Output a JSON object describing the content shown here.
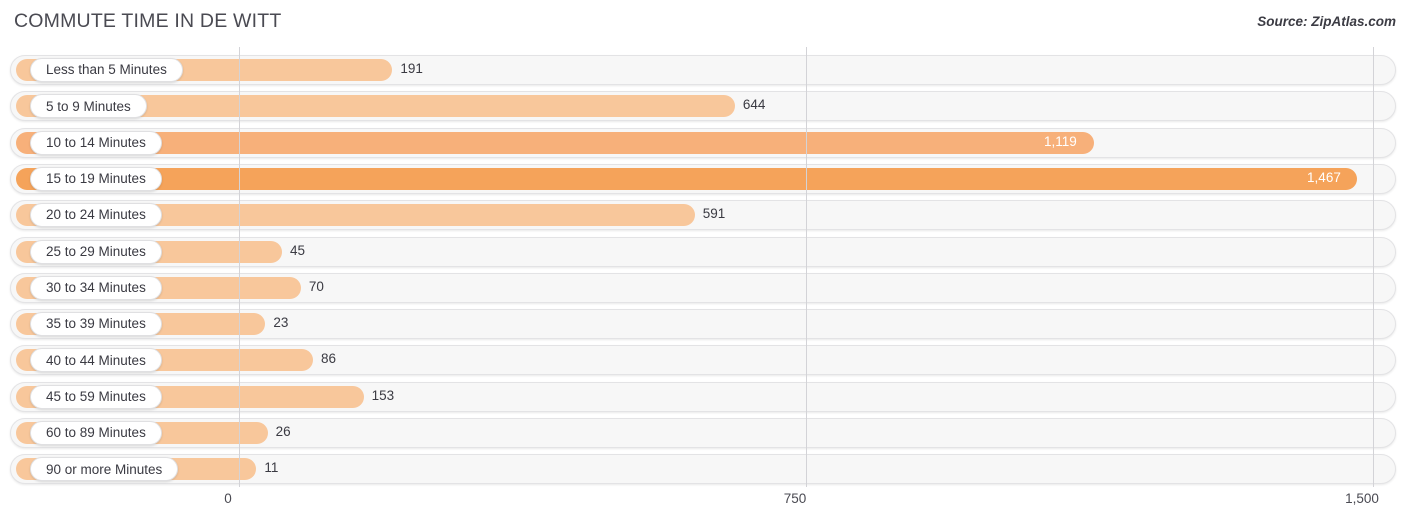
{
  "header": {
    "title": "COMMUTE TIME IN DE WITT",
    "source": "Source: ZipAtlas.com"
  },
  "axis": {
    "ticks": [
      {
        "label": "0",
        "value": 0
      },
      {
        "label": "750",
        "value": 750
      },
      {
        "label": "1,500",
        "value": 1500
      }
    ]
  },
  "colors": {
    "bar_light": "#f8c79b",
    "bar_mid": "#f7b97f",
    "bar_dark": "#f5a65e",
    "bar_darkest": "#f49f50",
    "track_bg": "#f7f7f7",
    "track_border": "#e3e3e5",
    "gridline": "#d3d3d7",
    "text": "#3a3a42",
    "title_text": "#4a4a52"
  },
  "chart_data": {
    "type": "bar",
    "orientation": "horizontal",
    "title": "COMMUTE TIME IN DE WITT",
    "xlabel": "",
    "ylabel": "",
    "xlim": [
      0,
      1500
    ],
    "grid": true,
    "legend": false,
    "source": "Source: ZipAtlas.com",
    "categories": [
      "Less than 5 Minutes",
      "5 to 9 Minutes",
      "10 to 14 Minutes",
      "15 to 19 Minutes",
      "20 to 24 Minutes",
      "25 to 29 Minutes",
      "30 to 34 Minutes",
      "35 to 39 Minutes",
      "40 to 44 Minutes",
      "45 to 59 Minutes",
      "60 to 89 Minutes",
      "90 or more Minutes"
    ],
    "values": [
      191,
      644,
      1119,
      1467,
      591,
      45,
      70,
      23,
      86,
      153,
      26,
      11
    ],
    "value_labels": [
      "191",
      "644",
      "1,119",
      "1,467",
      "591",
      "45",
      "70",
      "23",
      "86",
      "153",
      "26",
      "11"
    ],
    "bars": [
      {
        "category": "Less than 5 Minutes",
        "value": 191,
        "label": "191",
        "color": "#f8c79b",
        "label_inside": false
      },
      {
        "category": "5 to 9 Minutes",
        "value": 644,
        "label": "644",
        "color": "#f8c79b",
        "label_inside": false
      },
      {
        "category": "10 to 14 Minutes",
        "value": 1119,
        "label": "1,119",
        "color": "#f7b07a",
        "label_inside": true
      },
      {
        "category": "15 to 19 Minutes",
        "value": 1467,
        "label": "1,467",
        "color": "#f5a35a",
        "label_inside": true
      },
      {
        "category": "20 to 24 Minutes",
        "value": 591,
        "label": "591",
        "color": "#f8c79b",
        "label_inside": false
      },
      {
        "category": "25 to 29 Minutes",
        "value": 45,
        "label": "45",
        "color": "#f8c79b",
        "label_inside": false
      },
      {
        "category": "30 to 34 Minutes",
        "value": 70,
        "label": "70",
        "color": "#f8c79b",
        "label_inside": false
      },
      {
        "category": "35 to 39 Minutes",
        "value": 23,
        "label": "23",
        "color": "#f8c79b",
        "label_inside": false
      },
      {
        "category": "40 to 44 Minutes",
        "value": 86,
        "label": "86",
        "color": "#f8c79b",
        "label_inside": false
      },
      {
        "category": "45 to 59 Minutes",
        "value": 153,
        "label": "153",
        "color": "#f8c79b",
        "label_inside": false
      },
      {
        "category": "60 to 89 Minutes",
        "value": 26,
        "label": "26",
        "color": "#f8c79b",
        "label_inside": false
      },
      {
        "category": "90 or more Minutes",
        "value": 11,
        "label": "11",
        "color": "#f8c79b",
        "label_inside": false
      }
    ]
  }
}
